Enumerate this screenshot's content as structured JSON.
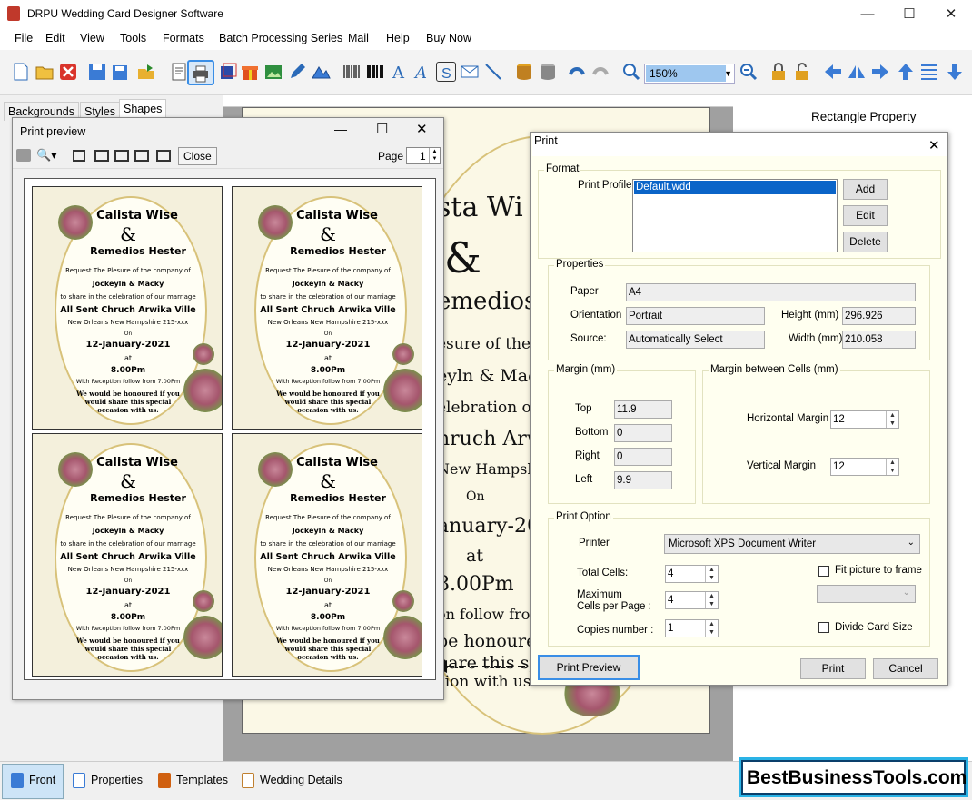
{
  "window": {
    "title": "DRPU Wedding Card Designer Software"
  },
  "menu": [
    "File",
    "Edit",
    "View",
    "Tools",
    "Formats",
    "Batch Processing Series",
    "Mail",
    "Help",
    "Buy Now"
  ],
  "toolbar": {
    "zoom": "150%"
  },
  "left_tabs": [
    "Backgrounds",
    "Styles",
    "Shapes"
  ],
  "right_panel": {
    "title": "Rectangle Property"
  },
  "card": {
    "name1": "Calista Wise",
    "amp": "&",
    "name2": "Remedios Hester",
    "line1": "Request The Plesure of the company of",
    "hosts": "Jockeyln & Macky",
    "line2": "to share in the celebration of our marriage",
    "venue": "All Sent Chruch Arwika Ville",
    "address": "New Orleans New Hampshire 215-xxx",
    "on": "On",
    "date": "12-January-2021",
    "at": "at",
    "time": "8.00Pm",
    "reception": "With Reception follow from 7.00Pm",
    "closing1": "We would be honoured if you",
    "closing2": "would share this special",
    "closing3": "occasion with us."
  },
  "card_partial": {
    "l1": "sta Wi",
    "l2": "&",
    "l3": "emedios",
    "l4": "esure of the",
    "l5": "eyln & Mac",
    "l6": "elebration of",
    "l7": "hruch Arw",
    "l8": "New Hampsh",
    "l9": "On",
    "l10": "anuary-202",
    "l11": "at",
    "l12": "8.00Pm",
    "l13": "on follow fro",
    "l14": "be honoure",
    "l15": "hare this sp",
    "l16": "sion with us"
  },
  "print_preview": {
    "title": "Print preview",
    "close_label": "Close",
    "page_label": "Page",
    "page_value": "1"
  },
  "print_dialog": {
    "title": "Print",
    "format_group": "Format",
    "print_profile_label": "Print Profile",
    "profile_item": "Default.wdd",
    "add": "Add",
    "edit": "Edit",
    "delete": "Delete",
    "properties_group": "Properties",
    "paper_label": "Paper",
    "paper": "A4",
    "orientation_label": "Orientation",
    "orientation": "Portrait",
    "source_label": "Source:",
    "source": "Automatically Select",
    "height_label": "Height (mm)",
    "height": "296.926",
    "width_label": "Width (mm)",
    "width": "210.058",
    "margin_group": "Margin (mm)",
    "top_label": "Top",
    "top": "11.9",
    "bottom_label": "Bottom",
    "bottom": "0",
    "right_label": "Right",
    "right": "0",
    "left_label": "Left",
    "left": "9.9",
    "cells_group": "Margin between Cells (mm)",
    "hmargin_label": "Horizontal Margin",
    "hmargin": "12",
    "vmargin_label": "Vertical Margin",
    "vmargin": "12",
    "option_group": "Print Option",
    "printer_label": "Printer",
    "printer": "Microsoft XPS Document Writer",
    "total_cells_label": "Total Cells:",
    "total_cells": "4",
    "max_cells_label1": "Maximum",
    "max_cells_label2": "Cells per Page :",
    "max_cells": "4",
    "copies_label": "Copies number :",
    "copies": "1",
    "fit_label": "Fit picture to frame",
    "divide_label": "Divide Card Size",
    "preview_btn": "Print Preview",
    "print_btn": "Print",
    "cancel_btn": "Cancel"
  },
  "bottom_tabs": [
    "Front",
    "Properties",
    "Templates",
    "Wedding Details"
  ],
  "brand": "BestBusinessTools.com"
}
